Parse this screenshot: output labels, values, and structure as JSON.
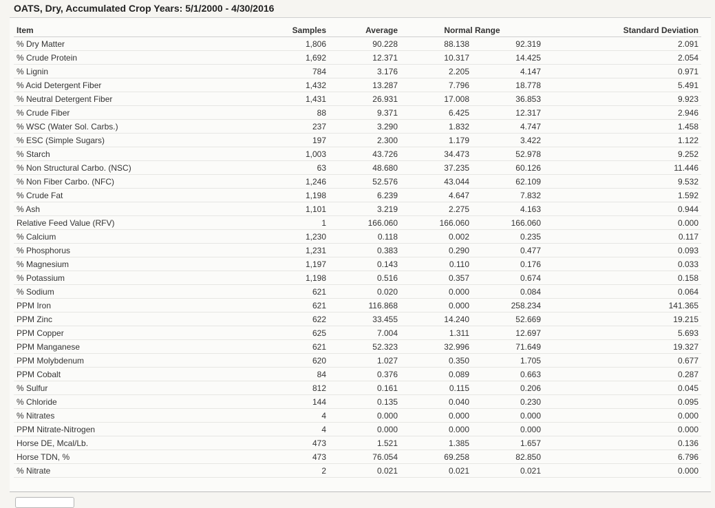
{
  "title": "OATS, Dry, Accumulated Crop Years: 5/1/2000 - 4/30/2016",
  "headers": {
    "item": "Item",
    "samples": "Samples",
    "average": "Average",
    "normal_range": "Normal Range",
    "std_dev": "Standard Deviation"
  },
  "rows": [
    {
      "item": "% Dry Matter",
      "samples": "1,806",
      "average": "90.228",
      "low": "88.138",
      "high": "92.319",
      "sd": "2.091"
    },
    {
      "item": "% Crude Protein",
      "samples": "1,692",
      "average": "12.371",
      "low": "10.317",
      "high": "14.425",
      "sd": "2.054"
    },
    {
      "item": "% Lignin",
      "samples": "784",
      "average": "3.176",
      "low": "2.205",
      "high": "4.147",
      "sd": "0.971"
    },
    {
      "item": "% Acid Detergent Fiber",
      "samples": "1,432",
      "average": "13.287",
      "low": "7.796",
      "high": "18.778",
      "sd": "5.491"
    },
    {
      "item": "% Neutral Detergent Fiber",
      "samples": "1,431",
      "average": "26.931",
      "low": "17.008",
      "high": "36.853",
      "sd": "9.923"
    },
    {
      "item": "% Crude Fiber",
      "samples": "88",
      "average": "9.371",
      "low": "6.425",
      "high": "12.317",
      "sd": "2.946"
    },
    {
      "item": "% WSC (Water Sol. Carbs.)",
      "samples": "237",
      "average": "3.290",
      "low": "1.832",
      "high": "4.747",
      "sd": "1.458"
    },
    {
      "item": "% ESC (Simple Sugars)",
      "samples": "197",
      "average": "2.300",
      "low": "1.179",
      "high": "3.422",
      "sd": "1.122"
    },
    {
      "item": "% Starch",
      "samples": "1,003",
      "average": "43.726",
      "low": "34.473",
      "high": "52.978",
      "sd": "9.252"
    },
    {
      "item": "% Non Structural Carbo. (NSC)",
      "samples": "63",
      "average": "48.680",
      "low": "37.235",
      "high": "60.126",
      "sd": "11.446"
    },
    {
      "item": "% Non Fiber Carbo. (NFC)",
      "samples": "1,246",
      "average": "52.576",
      "low": "43.044",
      "high": "62.109",
      "sd": "9.532"
    },
    {
      "item": "% Crude Fat",
      "samples": "1,198",
      "average": "6.239",
      "low": "4.647",
      "high": "7.832",
      "sd": "1.592"
    },
    {
      "item": "% Ash",
      "samples": "1,101",
      "average": "3.219",
      "low": "2.275",
      "high": "4.163",
      "sd": "0.944"
    },
    {
      "item": "Relative Feed Value (RFV)",
      "samples": "1",
      "average": "166.060",
      "low": "166.060",
      "high": "166.060",
      "sd": "0.000"
    },
    {
      "item": "% Calcium",
      "samples": "1,230",
      "average": "0.118",
      "low": "0.002",
      "high": "0.235",
      "sd": "0.117"
    },
    {
      "item": "% Phosphorus",
      "samples": "1,231",
      "average": "0.383",
      "low": "0.290",
      "high": "0.477",
      "sd": "0.093"
    },
    {
      "item": "% Magnesium",
      "samples": "1,197",
      "average": "0.143",
      "low": "0.110",
      "high": "0.176",
      "sd": "0.033"
    },
    {
      "item": "% Potassium",
      "samples": "1,198",
      "average": "0.516",
      "low": "0.357",
      "high": "0.674",
      "sd": "0.158"
    },
    {
      "item": "% Sodium",
      "samples": "621",
      "average": "0.020",
      "low": "0.000",
      "high": "0.084",
      "sd": "0.064"
    },
    {
      "item": "PPM Iron",
      "samples": "621",
      "average": "116.868",
      "low": "0.000",
      "high": "258.234",
      "sd": "141.365"
    },
    {
      "item": "PPM Zinc",
      "samples": "622",
      "average": "33.455",
      "low": "14.240",
      "high": "52.669",
      "sd": "19.215"
    },
    {
      "item": "PPM Copper",
      "samples": "625",
      "average": "7.004",
      "low": "1.311",
      "high": "12.697",
      "sd": "5.693"
    },
    {
      "item": "PPM Manganese",
      "samples": "621",
      "average": "52.323",
      "low": "32.996",
      "high": "71.649",
      "sd": "19.327"
    },
    {
      "item": "PPM Molybdenum",
      "samples": "620",
      "average": "1.027",
      "low": "0.350",
      "high": "1.705",
      "sd": "0.677"
    },
    {
      "item": "PPM Cobalt",
      "samples": "84",
      "average": "0.376",
      "low": "0.089",
      "high": "0.663",
      "sd": "0.287"
    },
    {
      "item": "% Sulfur",
      "samples": "812",
      "average": "0.161",
      "low": "0.115",
      "high": "0.206",
      "sd": "0.045"
    },
    {
      "item": "% Chloride",
      "samples": "144",
      "average": "0.135",
      "low": "0.040",
      "high": "0.230",
      "sd": "0.095"
    },
    {
      "item": "% Nitrates",
      "samples": "4",
      "average": "0.000",
      "low": "0.000",
      "high": "0.000",
      "sd": "0.000"
    },
    {
      "item": "PPM Nitrate-Nitrogen",
      "samples": "4",
      "average": "0.000",
      "low": "0.000",
      "high": "0.000",
      "sd": "0.000"
    },
    {
      "item": "Horse DE, Mcal/Lb.",
      "samples": "473",
      "average": "1.521",
      "low": "1.385",
      "high": "1.657",
      "sd": "0.136"
    },
    {
      "item": "Horse TDN, %",
      "samples": "473",
      "average": "76.054",
      "low": "69.258",
      "high": "82.850",
      "sd": "6.796"
    },
    {
      "item": "% Nitrate",
      "samples": "2",
      "average": "0.021",
      "low": "0.021",
      "high": "0.021",
      "sd": "0.000"
    }
  ]
}
